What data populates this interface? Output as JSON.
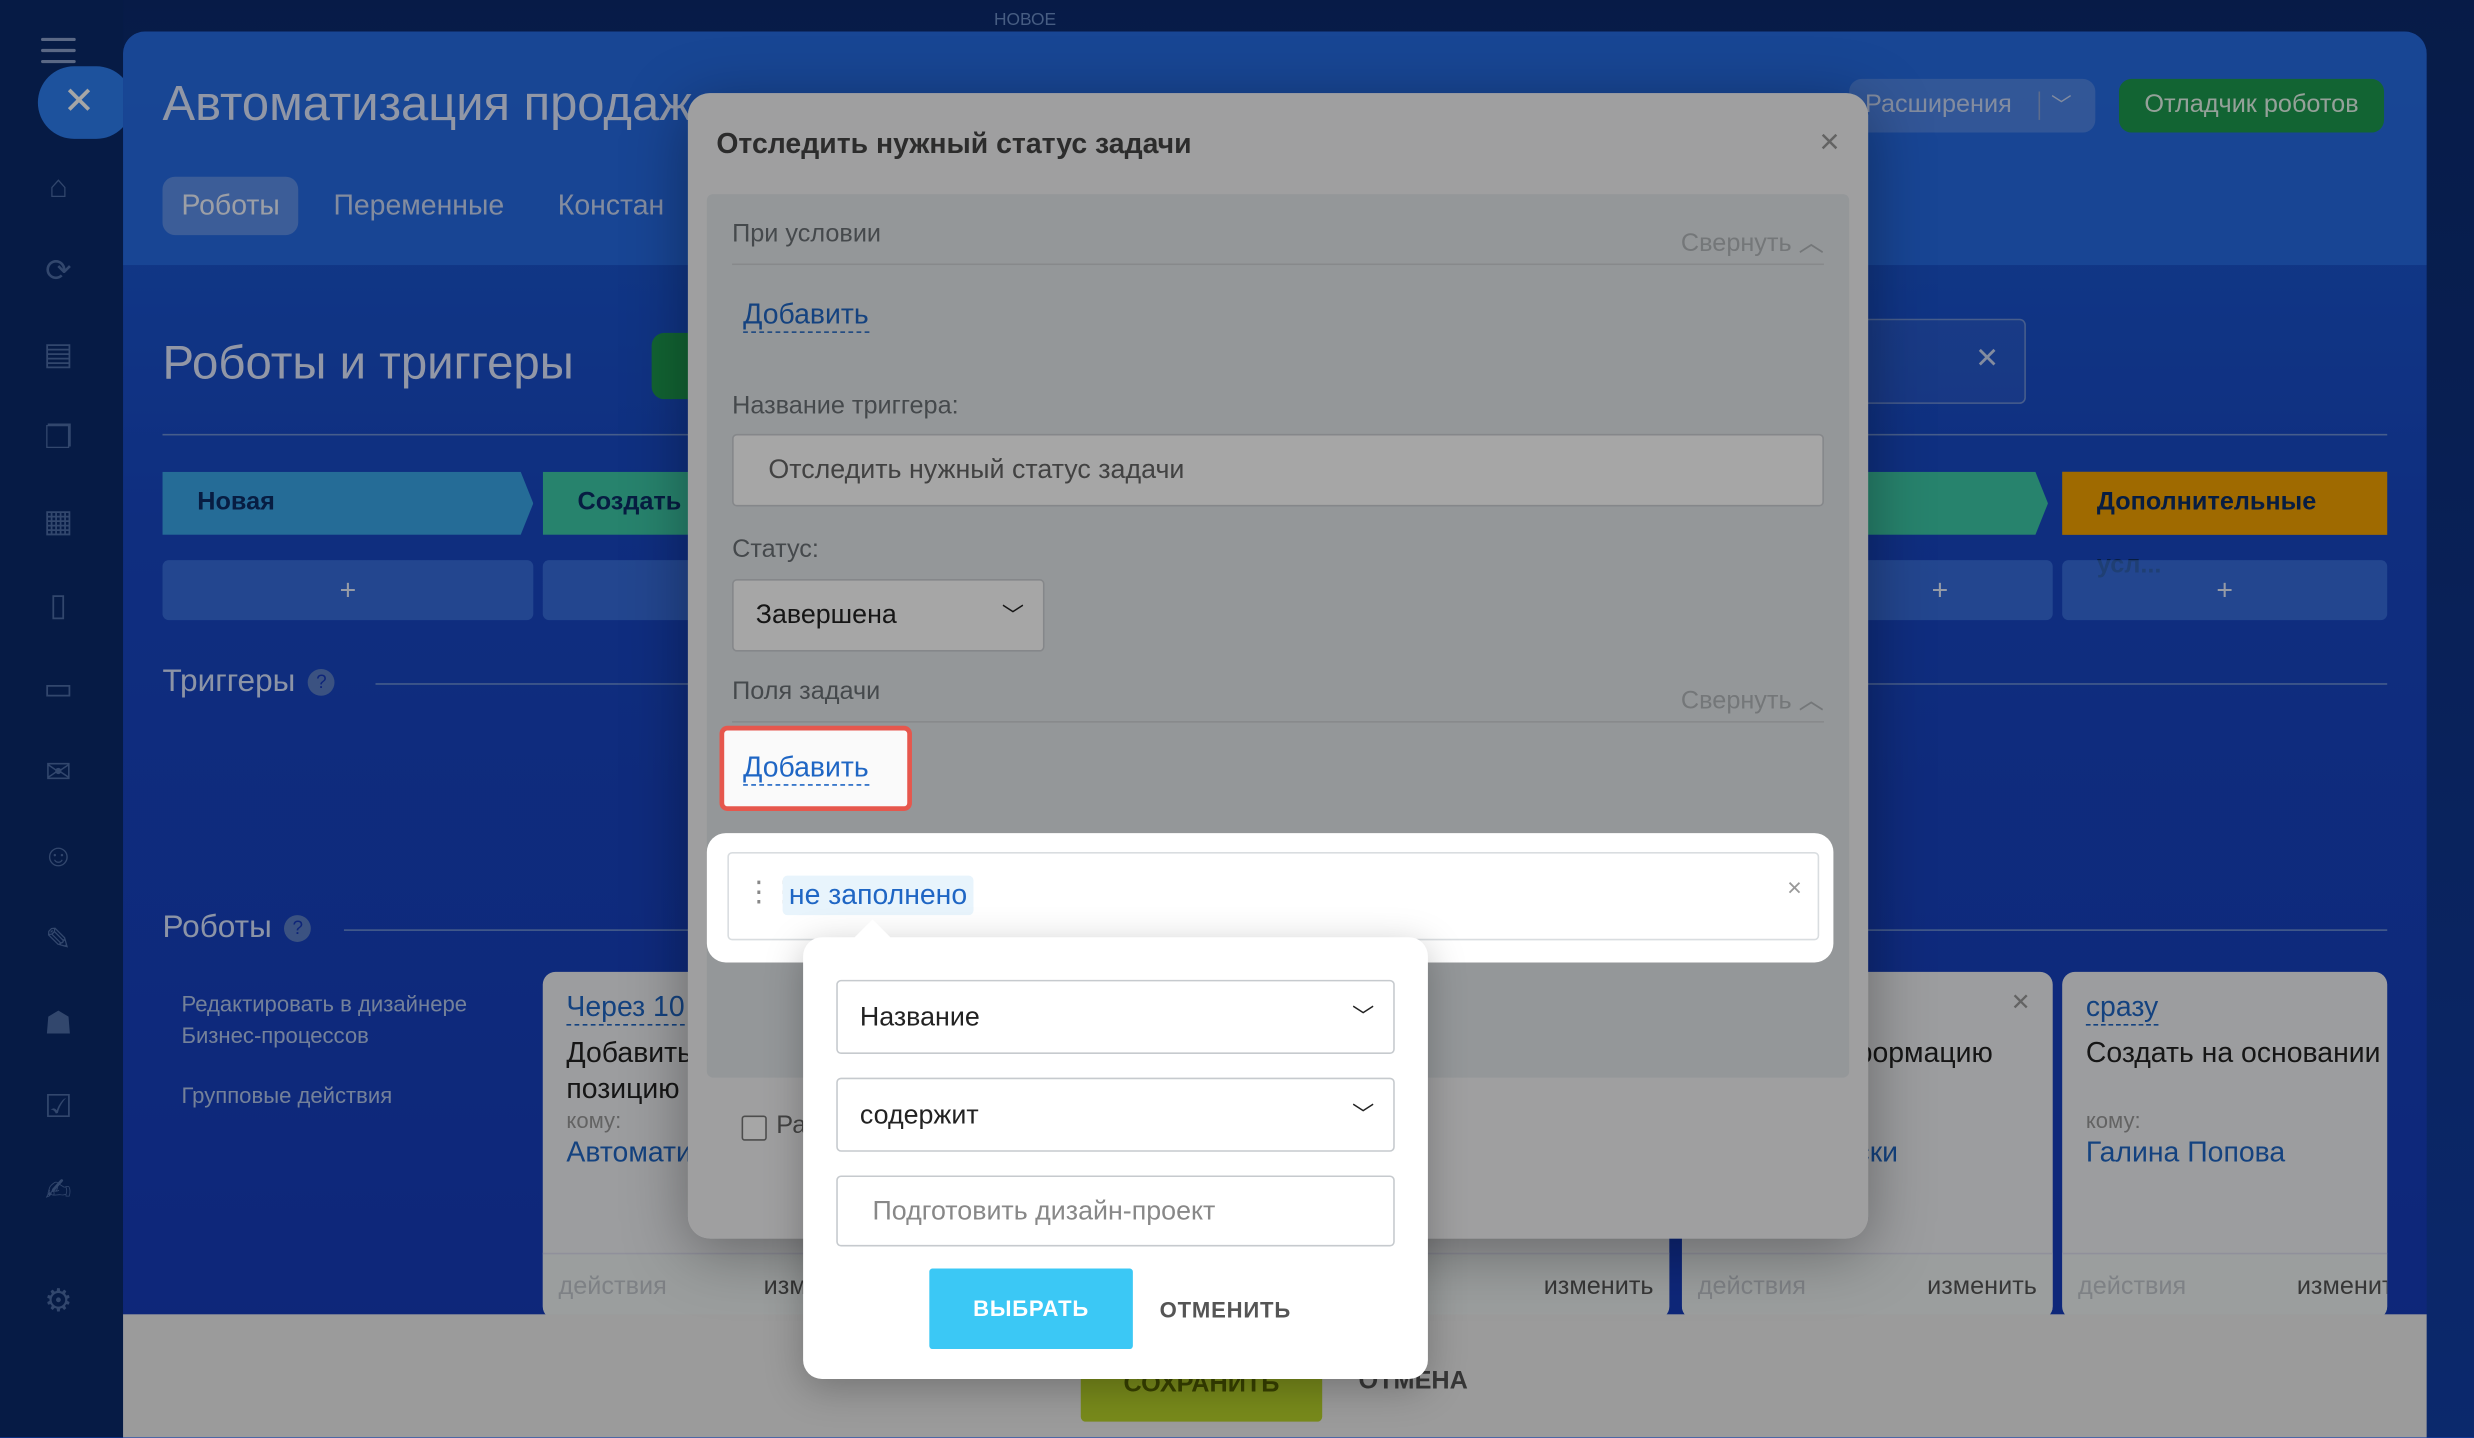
{
  "app": {
    "new_label": "НОВОЕ",
    "title": "Автоматизация продаж",
    "tabs": [
      "Роботы",
      "Переменные",
      "Констан"
    ],
    "extensions_label": "Расширения",
    "debugger_label": "Отладчик роботов"
  },
  "robots_page": {
    "title": "Роботы и триггеры",
    "stages": [
      {
        "label": "Новая",
        "color": "#3aa6e8"
      },
      {
        "label": "Создать",
        "color": "#3cc9a8"
      },
      {
        "label": "Дополнительные усл...",
        "color": "#f5a300"
      }
    ],
    "plus": "+",
    "triggers_heading": "Триггеры",
    "robots_heading": "Роботы",
    "help": "?",
    "side_links": [
      "Редактировать в дизайнере Бизнес-процессов",
      "Групповые действия"
    ],
    "cards": [
      {
        "when": "Через 10",
        "desc_1": "Добавить",
        "desc_2": "позицию",
        "to": "кому:",
        "who": "Автомати",
        "actions": "действия",
        "edit": "изм"
      },
      {
        "when": "",
        "desc_1": "нформацию",
        "desc_2": "х",
        "to": "",
        "who": "ски",
        "actions": "",
        "edit": "изменить"
      },
      {
        "when": "",
        "desc_1": "",
        "desc_2": "",
        "to": "",
        "who": "",
        "actions": "действия",
        "edit": "изменить"
      },
      {
        "when": "сразу",
        "desc_1": "Создать на основании",
        "desc_2": "",
        "to": "кому:",
        "who": "Галина Попова",
        "actions": "действия",
        "edit": "изменит"
      }
    ],
    "peek_text": "ить",
    "save_label": "СОХРАНИТЬ",
    "cancel_label": "ОТМЕНА"
  },
  "modal": {
    "title": "Отследить нужный статус задачи",
    "close": "×",
    "condition_label": "При условии",
    "collapse_label": "Свернуть",
    "add_label": "Добавить",
    "trigger_name_label": "Название триггера:",
    "trigger_name_value": "Отследить нужный статус задачи",
    "status_label": "Статус:",
    "status_value": "Завершена",
    "task_fields_label": "Поля задачи",
    "checkbox_label": "Ра"
  },
  "condition": {
    "value_chip": "не заполнено",
    "remove": "×"
  },
  "popup": {
    "field_select": "Название",
    "operator_select": "содержит",
    "value_input": "Подготовить дизайн-проект",
    "choose_label": "ВЫБРАТЬ",
    "cancel_label": "ОТМЕНИТЬ"
  },
  "colors": {
    "accent": "#1f66c4",
    "highlight_border": "#e6574d",
    "choose_button": "#3bc8f5",
    "debug_button": "#1d9a4f"
  }
}
